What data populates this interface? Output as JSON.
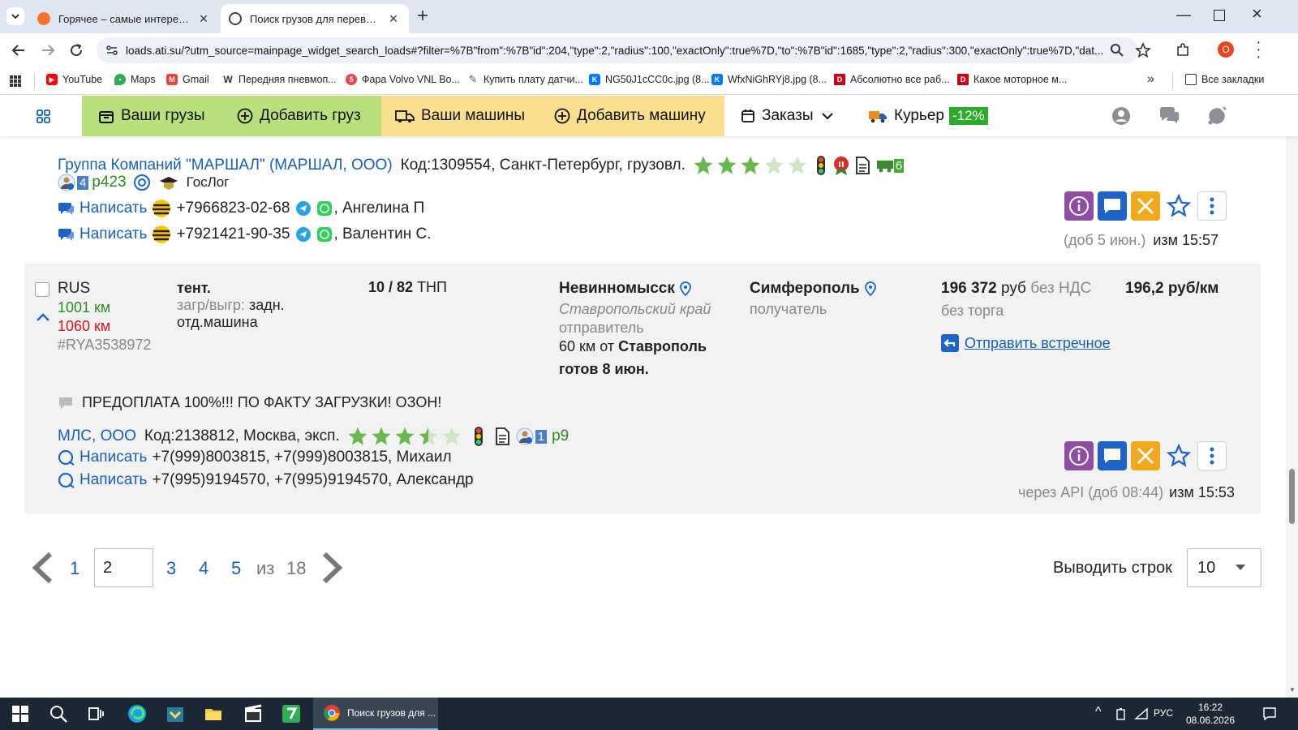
{
  "browser": {
    "tabs": [
      {
        "title": "Горячее – самые интересные",
        "active": false
      },
      {
        "title": "Поиск грузов для перевозки н",
        "active": true
      }
    ],
    "new_tab": "+",
    "url": "loads.ati.su/?utm_source=mainpage_widget_search_loads#?filter=%7B\"from\":%7B\"id\":204,\"type\":2,\"radius\":100,\"exactOnly\":true%7D,\"to\":%7B\"id\":1685,\"type\":2,\"radius\":300,\"exactOnly\":true%7D,\"dat...",
    "profile_initial": "O",
    "bookmarks": [
      {
        "label": "YouTube",
        "icon": "youtube-icon",
        "color": "#ff0000"
      },
      {
        "label": "Maps",
        "icon": "maps-icon",
        "color": "#34a853"
      },
      {
        "label": "Gmail",
        "icon": "gmail-icon",
        "color": "#ea4335"
      },
      {
        "label": "Передняя пневмоп...",
        "icon": "w-icon",
        "color": "#333333"
      },
      {
        "label": "Фара Volvo VNL Bo...",
        "icon": "red-circle-icon",
        "color": "#e5484d"
      },
      {
        "label": "Купить плату датчи...",
        "icon": "tool-icon",
        "color": "#555555"
      },
      {
        "label": "NG50J1cCC0c.jpg (8...",
        "icon": "vk-icon",
        "color": "#0077ff"
      },
      {
        "label": "WfxNiGhRYj8.jpg (8...",
        "icon": "vk-icon",
        "color": "#0077ff"
      },
      {
        "label": "Абсолютно все раб...",
        "icon": "d-icon",
        "color": "#c4001b"
      },
      {
        "label": "Какое моторное м...",
        "icon": "d-icon",
        "color": "#c4001b"
      }
    ],
    "all_bookmarks": "Все закладки"
  },
  "nav": {
    "your_loads": "Ваши грузы",
    "add_load": "Добавить груз",
    "your_trucks": "Ваши машины",
    "add_truck": "Добавить машину",
    "orders": "Заказы",
    "courier": "Курьер",
    "courier_badge": "-12%"
  },
  "card1": {
    "company": "Группа Компаний \"МАРШАЛ\" (МАРШАЛ, ООО)",
    "details": "Код:1309554, Санкт-Петербург, грузовл.",
    "rating": 3,
    "trucks_count": "6",
    "users_count": "4",
    "points": "р423",
    "goslog": "ГосЛог",
    "contacts": [
      {
        "write": "Написать",
        "phone": "+7966823-02-68",
        "name": ", Ангелина П"
      },
      {
        "write": "Написать",
        "phone": "+7921421-90-35",
        "name": ", Валентин С."
      }
    ],
    "added": "(доб 5 июн.)",
    "changed": "изм 15:57"
  },
  "card2": {
    "country": "RUS",
    "dist_green": "1001 км",
    "dist_red": "1060 км",
    "id": "#RYA3538972",
    "body_type": "тент.",
    "loading_label": "загр/выгр:",
    "loading_value": "задн.",
    "truck_type": "отд.машина",
    "weight_volume": "10 / 82",
    "cargo": "ТНП",
    "from_city": "Невинномысск",
    "from_region": "Ставропольский край",
    "from_role": "отправитель",
    "from_distance": "60 км от",
    "from_distance_city": "Ставрополь",
    "ready": "готов 8 июн.",
    "to_city": "Симферополь",
    "to_role": "получатель",
    "price": "196 372",
    "price_unit": "руб",
    "vat": "без НДС",
    "per_km": "196,2 руб/км",
    "no_bargain": "без торга",
    "counter_offer": "Отправить встречное",
    "note": "ПРЕДОПЛАТА 100%!!! ПО ФАКТУ ЗАГРУЗКИ! ОЗОН!",
    "company": "МЛС, ООО",
    "details": "Код:2138812, Москва, эксп.",
    "rating": 3.5,
    "users_count": "1",
    "points": "р9",
    "contacts": [
      {
        "write": "Написать",
        "text": "+7(999)8003815, +7(999)8003815, Михаил"
      },
      {
        "write": "Написать",
        "text": "+7(995)9194570, +7(995)9194570, Александр"
      }
    ],
    "via_api": "через API",
    "added": "(доб 08:44)",
    "changed": "изм 15:53"
  },
  "pagination": {
    "pages": [
      "1",
      "2",
      "3",
      "4",
      "5"
    ],
    "current": "2",
    "of_label": "из",
    "total": "18",
    "rows_label": "Выводить строк",
    "rows_value": "10"
  },
  "taskbar": {
    "active_app": "Поиск грузов для ...",
    "lang": "РУС",
    "time": "16:22",
    "date": "08.06.2026"
  },
  "colors": {
    "loads_bg": "#b9e07c",
    "trucks_bg": "#f9df8f",
    "link": "#1a5fb4",
    "action_purple": "#8e4fa3",
    "action_blue": "#1f63c6",
    "action_orange": "#f0a81c",
    "star_green": "#69b84f"
  }
}
